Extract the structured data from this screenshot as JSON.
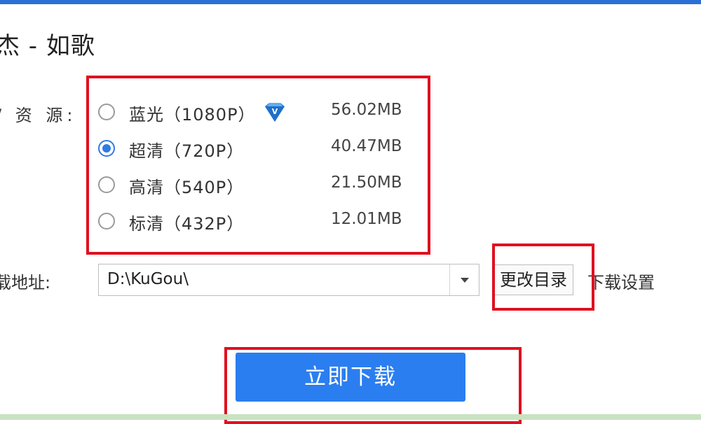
{
  "song_title": "杰 - 如歌",
  "quality": {
    "label": "/ 资 源:",
    "options": [
      {
        "label": "蓝光（1080P）",
        "size": "56.02MB",
        "selected": false,
        "vip": true
      },
      {
        "label": "超清（720P）",
        "size": "40.47MB",
        "selected": true,
        "vip": false
      },
      {
        "label": "高清（540P）",
        "size": "21.50MB",
        "selected": false,
        "vip": false
      },
      {
        "label": "标清（432P）",
        "size": "12.01MB",
        "selected": false,
        "vip": false
      }
    ]
  },
  "download_path": {
    "label": "载地址:",
    "value": "D:\\KuGou\\",
    "change_button": "更改目录",
    "settings_link": "下载设置"
  },
  "download_button": "立即下载",
  "colors": {
    "accent": "#2b7ef0",
    "highlight": "#e01020",
    "vip_icon": "#2a86e6"
  },
  "icons": {
    "vip": "diamond-vip-icon",
    "dropdown": "chevron-down-icon"
  }
}
